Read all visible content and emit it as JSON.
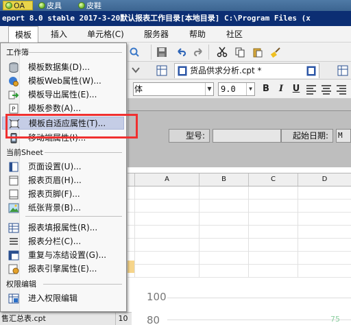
{
  "taskbar": {
    "items": [
      {
        "label": "OA"
      },
      {
        "label": "皮具"
      },
      {
        "label": "皮鞋"
      }
    ]
  },
  "window": {
    "title": "eport 8.0 stable 2017-3-20默认报表工作目录[本地目录]   C:\\Program Files (x"
  },
  "menubar": {
    "items": [
      {
        "label": "模板"
      },
      {
        "label": "插入"
      },
      {
        "label": "单元格(C)"
      },
      {
        "label": "服务器"
      },
      {
        "label": "帮助"
      },
      {
        "label": "社区"
      }
    ]
  },
  "editor": {
    "tab_label": "货品供求分析.cpt *",
    "font_name": "体",
    "font_size": "9.0",
    "fields": [
      {
        "label": "型号:"
      },
      {
        "label": "起始日期:"
      }
    ],
    "date_input_value": "M",
    "columns": [
      "A",
      "B",
      "C",
      "D"
    ]
  },
  "template_menu": {
    "sections": [
      {
        "title": "工作簿",
        "items": [
          {
            "label": "模板数据集(D)...",
            "icon": "database-icon"
          },
          {
            "label": "模板Web属性(W)...",
            "icon": "web-gear-icon"
          },
          {
            "label": "模板导出属性(E)...",
            "icon": "export-icon"
          },
          {
            "label": "模板参数(A)...",
            "icon": "parameter-icon"
          },
          {
            "label": "模板自适应属性(T)...",
            "icon": "adaptive-icon",
            "highlighted": true
          },
          {
            "label": "移动端属性(I)...",
            "icon": "mobile-icon"
          }
        ]
      },
      {
        "title": "当前Sheet",
        "items": [
          {
            "label": "页面设置(U)...",
            "icon": "page-setup-icon"
          },
          {
            "label": "报表页眉(H)...",
            "icon": "header-icon"
          },
          {
            "label": "报表页脚(F)...",
            "icon": "footer-icon"
          },
          {
            "label": "纸张背景(B)...",
            "icon": "background-image-icon"
          },
          {
            "label": "报表填报属性(R)...",
            "icon": "fill-report-icon"
          },
          {
            "label": "报表分栏(C)...",
            "icon": "columns-icon"
          },
          {
            "label": "重复与冻结设置(G)...",
            "icon": "freeze-icon"
          },
          {
            "label": "报表引擎属性(E)...",
            "icon": "engine-icon"
          }
        ]
      },
      {
        "title": "权限编辑",
        "items": [
          {
            "label": "进入权限编辑",
            "icon": "permission-icon"
          }
        ]
      }
    ]
  },
  "status": {
    "file_label": "售汇总表.cpt",
    "number": "10"
  },
  "chart_fragment": {
    "y_labels": [
      "100",
      "80"
    ],
    "corner_number": "75"
  },
  "colors": {
    "title_bar": "#0c2e73",
    "highlight_box": "#f03030",
    "menu_hover": "#c5cde6"
  }
}
